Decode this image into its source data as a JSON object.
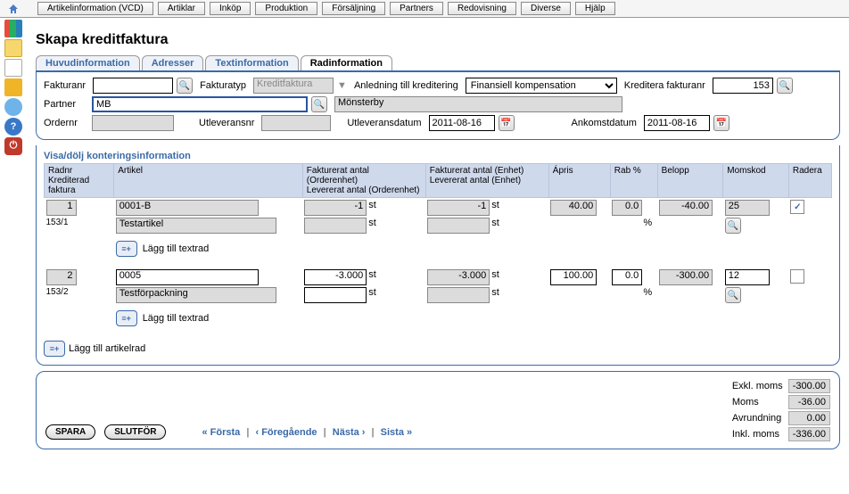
{
  "menu": [
    "Artikelinformation (VCD)",
    "Artiklar",
    "Inköp",
    "Produktion",
    "Försäljning",
    "Partners",
    "Redovisning",
    "Diverse",
    "Hjälp"
  ],
  "page_title": "Skapa kreditfaktura",
  "tabs": [
    "Huvudinformation",
    "Adresser",
    "Textinformation",
    "Radinformation"
  ],
  "active_tab": 3,
  "header": {
    "fakturanr_label": "Fakturanr",
    "fakturanr": "",
    "fakturatyp_label": "Fakturatyp",
    "fakturatyp": "Kreditfaktura",
    "anledning_label": "Anledning till kreditering",
    "anledning": "Finansiell kompensation",
    "kreditera_label": "Kreditera fakturanr",
    "kreditera": "153",
    "partner_label": "Partner",
    "partner": "MB",
    "partner_name": "Mönsterby",
    "ordernr_label": "Ordernr",
    "ordernr": "",
    "utlevnr_label": "Utleveransnr",
    "utlevnr": "",
    "utlevdatum_label": "Utleveransdatum",
    "utlevdatum": "2011-08-16",
    "ankomst_label": "Ankomstdatum",
    "ankomst": "2011-08-16"
  },
  "section_toggle": "Visa/dölj konteringsinformation",
  "columns": {
    "radnr": "Radnr\nKrediterad faktura",
    "artikel": "Artikel",
    "fakt_order": "Fakturerat antal (Orderenhet)\nLevererat antal (Orderenhet)",
    "fakt_enhet": "Fakturerat antal (Enhet)\nLevererat antal (Enhet)",
    "apris": "Ápris",
    "rab": "Rab %",
    "belopp": "Belopp",
    "momskod": "Momskod",
    "radera": "Radera"
  },
  "rows": [
    {
      "radnr": "1",
      "kred": "153/1",
      "art_code": "0001-B",
      "art_name": "Testartikel",
      "fakt_o": "-1",
      "unit_o": "st",
      "lev_o": "",
      "unit_o2": "st",
      "fakt_e": "-1",
      "unit_e": "st",
      "lev_e": "",
      "unit_e2": "st",
      "apris": "40.00",
      "rab": "0.0",
      "rab2": "%",
      "belopp": "-40.00",
      "moms": "25",
      "checked": true,
      "readonly": true
    },
    {
      "radnr": "2",
      "kred": "153/2",
      "art_code": "0005",
      "art_name": "Testförpackning",
      "fakt_o": "-3.000",
      "unit_o": "st",
      "lev_o": "",
      "unit_o2": "st",
      "fakt_e": "-3.000",
      "unit_e": "st",
      "lev_e": "",
      "unit_e2": "st",
      "apris": "100.00",
      "rab": "0.0",
      "rab2": "%",
      "belopp": "-300.00",
      "moms": "12",
      "checked": false,
      "readonly": false
    }
  ],
  "add_text_label": "Lägg till textrad",
  "add_line_label": "Lägg till artikelrad",
  "totals": {
    "exkl_label": "Exkl. moms",
    "exkl": "-300.00",
    "moms_label": "Moms",
    "moms": "-36.00",
    "avr_label": "Avrundning",
    "avr": "0.00",
    "inkl_label": "Inkl. moms",
    "inkl": "-336.00"
  },
  "buttons": {
    "spara": "SPARA",
    "slutfor": "SLUTFÖR"
  },
  "nav": {
    "first": "« Första",
    "prev": "‹ Föregående",
    "next": "Nästa ›",
    "last": "Sista »"
  }
}
